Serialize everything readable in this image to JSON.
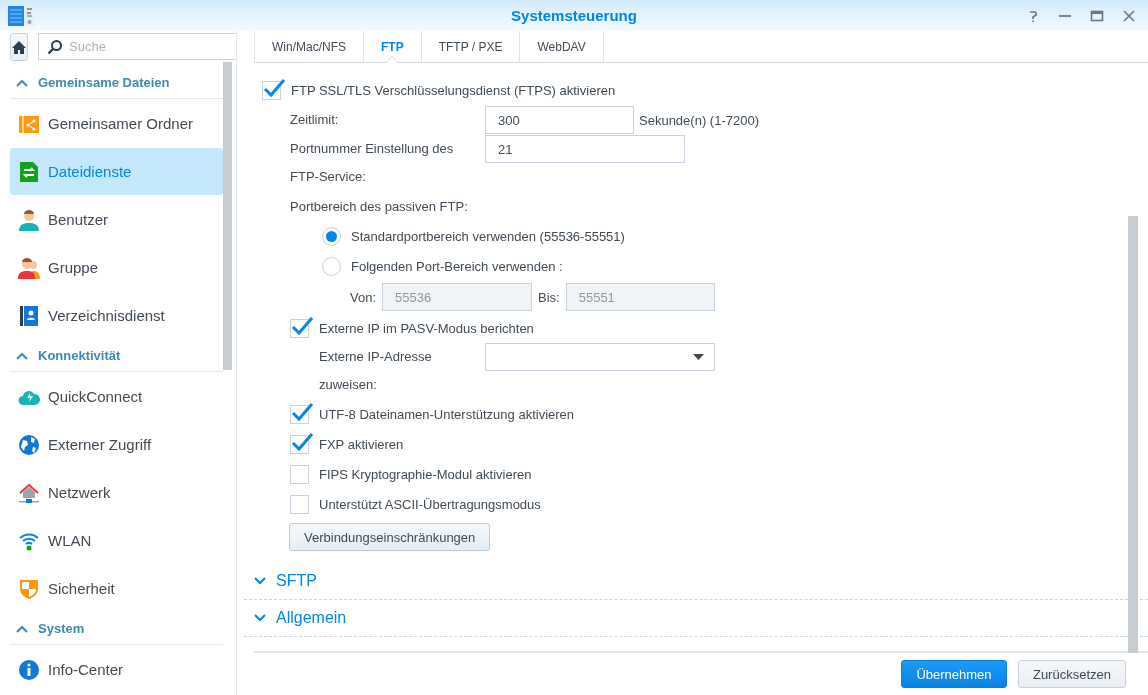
{
  "window": {
    "title": "Systemsteuerung"
  },
  "sidebar": {
    "search": {
      "placeholder": "Suche"
    },
    "sections": [
      {
        "title": "Gemeinsame Dateien",
        "expanded": true,
        "items": [
          {
            "label": "Gemeinsamer Ordner",
            "kind": "folder",
            "selected": false
          },
          {
            "label": "Dateidienste",
            "kind": "file",
            "selected": true
          },
          {
            "label": "Benutzer",
            "kind": "user",
            "selected": false
          },
          {
            "label": "Gruppe",
            "kind": "group",
            "selected": false
          },
          {
            "label": "Verzeichnisdienst",
            "kind": "book",
            "selected": false
          }
        ]
      },
      {
        "title": "Konnektivität",
        "expanded": true,
        "items": [
          {
            "label": "QuickConnect",
            "kind": "cloud",
            "selected": false
          },
          {
            "label": "Externer Zugriff",
            "kind": "globe",
            "selected": false
          },
          {
            "label": "Netzwerk",
            "kind": "house",
            "selected": false
          },
          {
            "label": "WLAN",
            "kind": "wifi",
            "selected": false
          },
          {
            "label": "Sicherheit",
            "kind": "shield",
            "selected": false
          }
        ]
      },
      {
        "title": "System",
        "expanded": true,
        "items": [
          {
            "label": "Info-Center",
            "kind": "info",
            "selected": false
          }
        ]
      }
    ]
  },
  "tabs": [
    {
      "label": "Win/Mac/NFS",
      "selected": false
    },
    {
      "label": "FTP",
      "selected": true
    },
    {
      "label": "TFTP / PXE",
      "selected": false
    },
    {
      "label": "WebDAV",
      "selected": false
    }
  ],
  "ftp": {
    "ftps": {
      "label": "FTP SSL/TLS Verschlüsselungsdienst (FTPS) aktivieren",
      "checked": true
    },
    "timeout": {
      "label": "Zeitlimit:",
      "value": "300",
      "unit": "Sekunde(n) (1-7200)"
    },
    "port": {
      "label": "Portnummer Einstellung des FTP-Service:",
      "value": "21"
    },
    "passive": {
      "label": "Portbereich des passiven FTP:",
      "options": [
        {
          "label": "Standardportbereich verwenden (55536-55551)",
          "selected": true
        },
        {
          "label": "Folgenden Port-Bereich verwenden :",
          "selected": false
        }
      ],
      "from": {
        "label": "Von:",
        "value": "55536",
        "disabled": true
      },
      "to": {
        "label": "Bis:",
        "value": "55551",
        "disabled": true
      }
    },
    "external_ip": {
      "label": "Externe IP im PASV-Modus berichten",
      "checked": true
    },
    "external_ip_address": {
      "label": "Externe IP-Adresse zuweisen:"
    },
    "options": [
      {
        "label": "UTF-8 Dateinamen-Unterstützung aktivieren",
        "checked": true
      },
      {
        "label": "FXP aktivieren",
        "checked": true
      },
      {
        "label": "FIPS Kryptographie-Modul aktivieren",
        "checked": false
      },
      {
        "label": "Unterstützt ASCII-Übertragungsmodus",
        "checked": false
      }
    ],
    "limits_button": "Verbindungseinschränkungen"
  },
  "sections": [
    {
      "label": "SFTP",
      "expanded": false
    },
    {
      "label": "Allgemein",
      "expanded": false
    }
  ],
  "footer": {
    "buttons": [
      {
        "label": "Übernehmen",
        "kind": "primary"
      },
      {
        "label": "Zurücksetzen",
        "kind": "secondary"
      }
    ]
  }
}
